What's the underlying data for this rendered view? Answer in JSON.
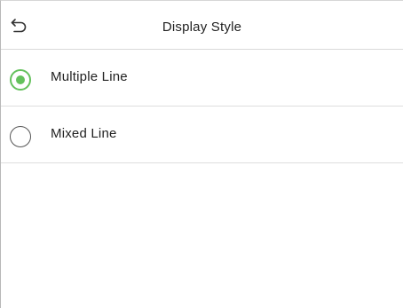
{
  "header": {
    "title": "Display Style",
    "back_icon": "back-arrow-icon"
  },
  "options": [
    {
      "label": "Multiple Line",
      "selected": true
    },
    {
      "label": "Mixed Line",
      "selected": false
    }
  ],
  "colors": {
    "accent": "#64c15c",
    "divider": "#dedede",
    "text": "#222222"
  }
}
